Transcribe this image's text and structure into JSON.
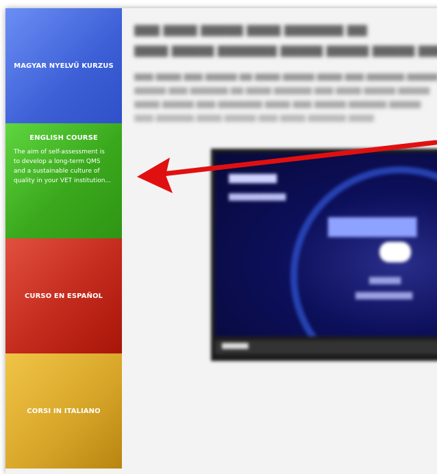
{
  "sidebar": {
    "hungarian": {
      "label": "MAGYAR NYELVŰ KURZUS"
    },
    "english": {
      "label": "ENGLISH COURSE",
      "description": "The aim of self-assessment is to develop a long-term QMS and a sustainable culture of quality in your VET institution..."
    },
    "spanish": {
      "label": "CURSO EN ESPAÑOL"
    },
    "italian": {
      "label": "CORSI IN ITALIANO"
    }
  },
  "colors": {
    "hungarian_tile": "#4a6ee0",
    "english_tile": "#3aa81c",
    "spanish_tile": "#c22a1c",
    "italian_tile": "#d8a72a",
    "arrow": "#e11010",
    "page_background": "#f3f3f3"
  },
  "content": {
    "video": {
      "play_icon": "play-icon"
    }
  },
  "annotations": {
    "arrow": "pointer-arrow"
  }
}
